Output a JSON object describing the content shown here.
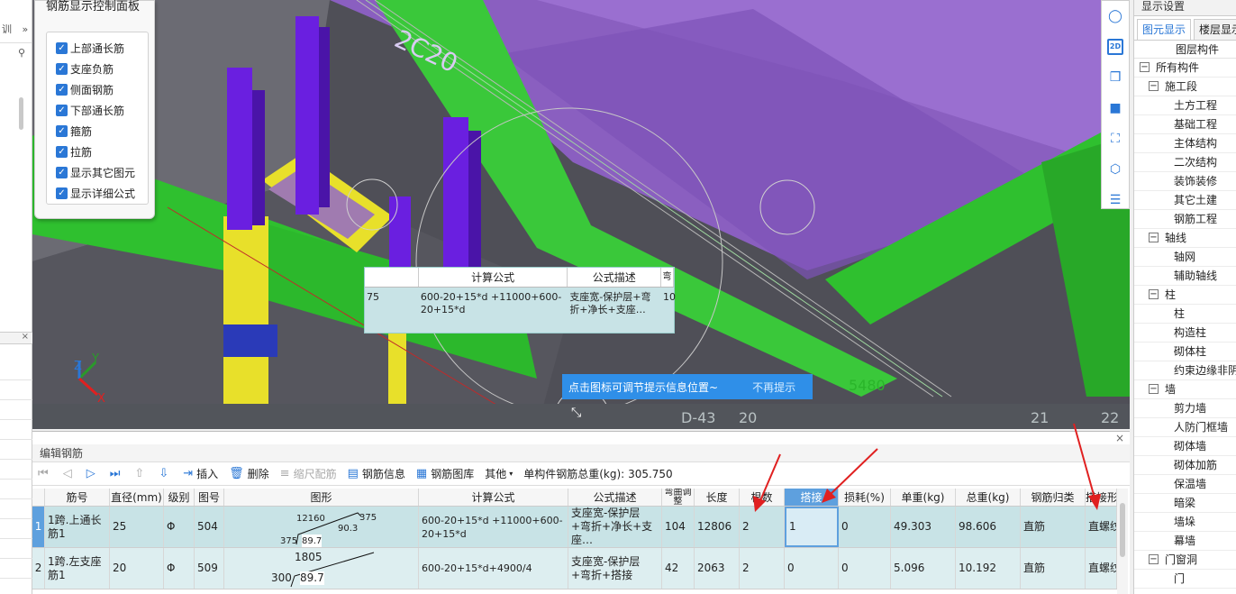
{
  "left_strip": {
    "top_label": "训"
  },
  "control_panel": {
    "title": "钢筋显示控制面板",
    "items": [
      {
        "label": "上部通长筋",
        "checked": true
      },
      {
        "label": "支座负筋",
        "checked": true
      },
      {
        "label": "侧面钢筋",
        "checked": true
      },
      {
        "label": "下部通长筋",
        "checked": true
      },
      {
        "label": "箍筋",
        "checked": true
      },
      {
        "label": "拉筋",
        "checked": true
      },
      {
        "label": "显示其它图元",
        "checked": true
      },
      {
        "label": "显示详细公式",
        "checked": true
      }
    ]
  },
  "viewport": {
    "beam_label": "2C20",
    "labels": {
      "d43": "D-43",
      "n20": "20",
      "n21": "21",
      "n22": "22",
      "green_5480": "5480"
    },
    "axis": {
      "x": "X",
      "y": "Y",
      "z": "Z"
    },
    "formula_popup": {
      "col_formula": "计算公式",
      "col_desc": "公式描述",
      "col_extra": "弯",
      "left_val": "75",
      "formula": "600-20+15*d +11000+600-20+15*d",
      "desc": "支座宽-保护层+弯折+净长+支座…",
      "right_val": "10"
    },
    "tip": {
      "text": "点击图标可调节提示信息位置~",
      "dismiss": "不再提示"
    }
  },
  "right_toolbar": {
    "view_2d": "2D"
  },
  "right_panel": {
    "title": "显示设置",
    "tabs": [
      {
        "label": "图元显示",
        "active": true
      },
      {
        "label": "楼层显示",
        "active": false
      }
    ],
    "column_header": "图层构件",
    "tree": [
      {
        "label": "所有构件",
        "level": 0,
        "toggle": "−"
      },
      {
        "label": "施工段",
        "level": 1,
        "toggle": "−"
      },
      {
        "label": "土方工程",
        "level": 2
      },
      {
        "label": "基础工程",
        "level": 2
      },
      {
        "label": "主体结构",
        "level": 2
      },
      {
        "label": "二次结构",
        "level": 2
      },
      {
        "label": "装饰装修",
        "level": 2
      },
      {
        "label": "其它土建",
        "level": 2
      },
      {
        "label": "钢筋工程",
        "level": 2
      },
      {
        "label": "轴线",
        "level": 1,
        "toggle": "−"
      },
      {
        "label": "轴网",
        "level": 2
      },
      {
        "label": "辅助轴线",
        "level": 2
      },
      {
        "label": "柱",
        "level": 1,
        "toggle": "−"
      },
      {
        "label": "柱",
        "level": 2
      },
      {
        "label": "构造柱",
        "level": 2
      },
      {
        "label": "砌体柱",
        "level": 2
      },
      {
        "label": "约束边缘非阴",
        "level": 2
      },
      {
        "label": "墙",
        "level": 1,
        "toggle": "−"
      },
      {
        "label": "剪力墙",
        "level": 2
      },
      {
        "label": "人防门框墙",
        "level": 2
      },
      {
        "label": "砌体墙",
        "level": 2
      },
      {
        "label": "砌体加筋",
        "level": 2
      },
      {
        "label": "保温墙",
        "level": 2
      },
      {
        "label": "暗梁",
        "level": 2
      },
      {
        "label": "墙垛",
        "level": 2
      },
      {
        "label": "幕墙",
        "level": 2
      },
      {
        "label": "门窗洞",
        "level": 1,
        "toggle": "−"
      },
      {
        "label": "门",
        "level": 2
      }
    ]
  },
  "editor": {
    "title": "编辑钢筋",
    "toolbar": {
      "insert": "插入",
      "delete": "删除",
      "scale": "缩尺配筋",
      "info": "钢筋信息",
      "library": "钢筋图库",
      "other": "其他",
      "total_label": "单构件钢筋总重(kg):",
      "total_value": "305.750"
    },
    "columns": [
      "筋号",
      "直径(mm)",
      "级别",
      "图号",
      "图形",
      "计算公式",
      "公式描述",
      "弯曲调整",
      "长度",
      "根数",
      "搭接",
      "损耗(%)",
      "单重(kg)",
      "总重(kg)",
      "钢筋归类",
      "搭接形式"
    ],
    "rows": [
      {
        "idx": "1",
        "name": "1跨.上通长筋1",
        "dia": "25",
        "grade": "Φ",
        "fig": "504",
        "shape_top": "12160",
        "shape_right": "375",
        "shape_left": "375",
        "shape_mid": "90.3",
        "shape_ang": "89.7",
        "formula": "600-20+15*d +11000+600-20+15*d",
        "desc": "支座宽-保护层+弯折+净长+支座…",
        "bend": "104",
        "length": "12806",
        "count": "2",
        "lap": "1",
        "loss": "0",
        "unit_w": "49.303",
        "total_w": "98.606",
        "cat": "直筋",
        "lap_type": "直螺纹"
      },
      {
        "idx": "2",
        "name": "1跨.左支座筋1",
        "dia": "20",
        "grade": "Φ",
        "fig": "509",
        "shape_top": "1805",
        "shape_right": "",
        "shape_left": "300",
        "shape_mid": "",
        "shape_ang": "89.7",
        "formula": "600-20+15*d+4900/4",
        "desc": "支座宽-保护层+弯折+搭接",
        "bend": "42",
        "length": "2063",
        "count": "2",
        "lap": "0",
        "loss": "0",
        "unit_w": "5.096",
        "total_w": "10.192",
        "cat": "直筋",
        "lap_type": "直螺纹"
      }
    ]
  },
  "colors": {
    "accent": "#2a77d6",
    "slab_purple": "#8a5fc0",
    "beam_green": "#2fc02f",
    "column_yellow": "#e8e02a",
    "rebar_violet": "#6a1fe0",
    "annotation_red": "#e02020"
  }
}
